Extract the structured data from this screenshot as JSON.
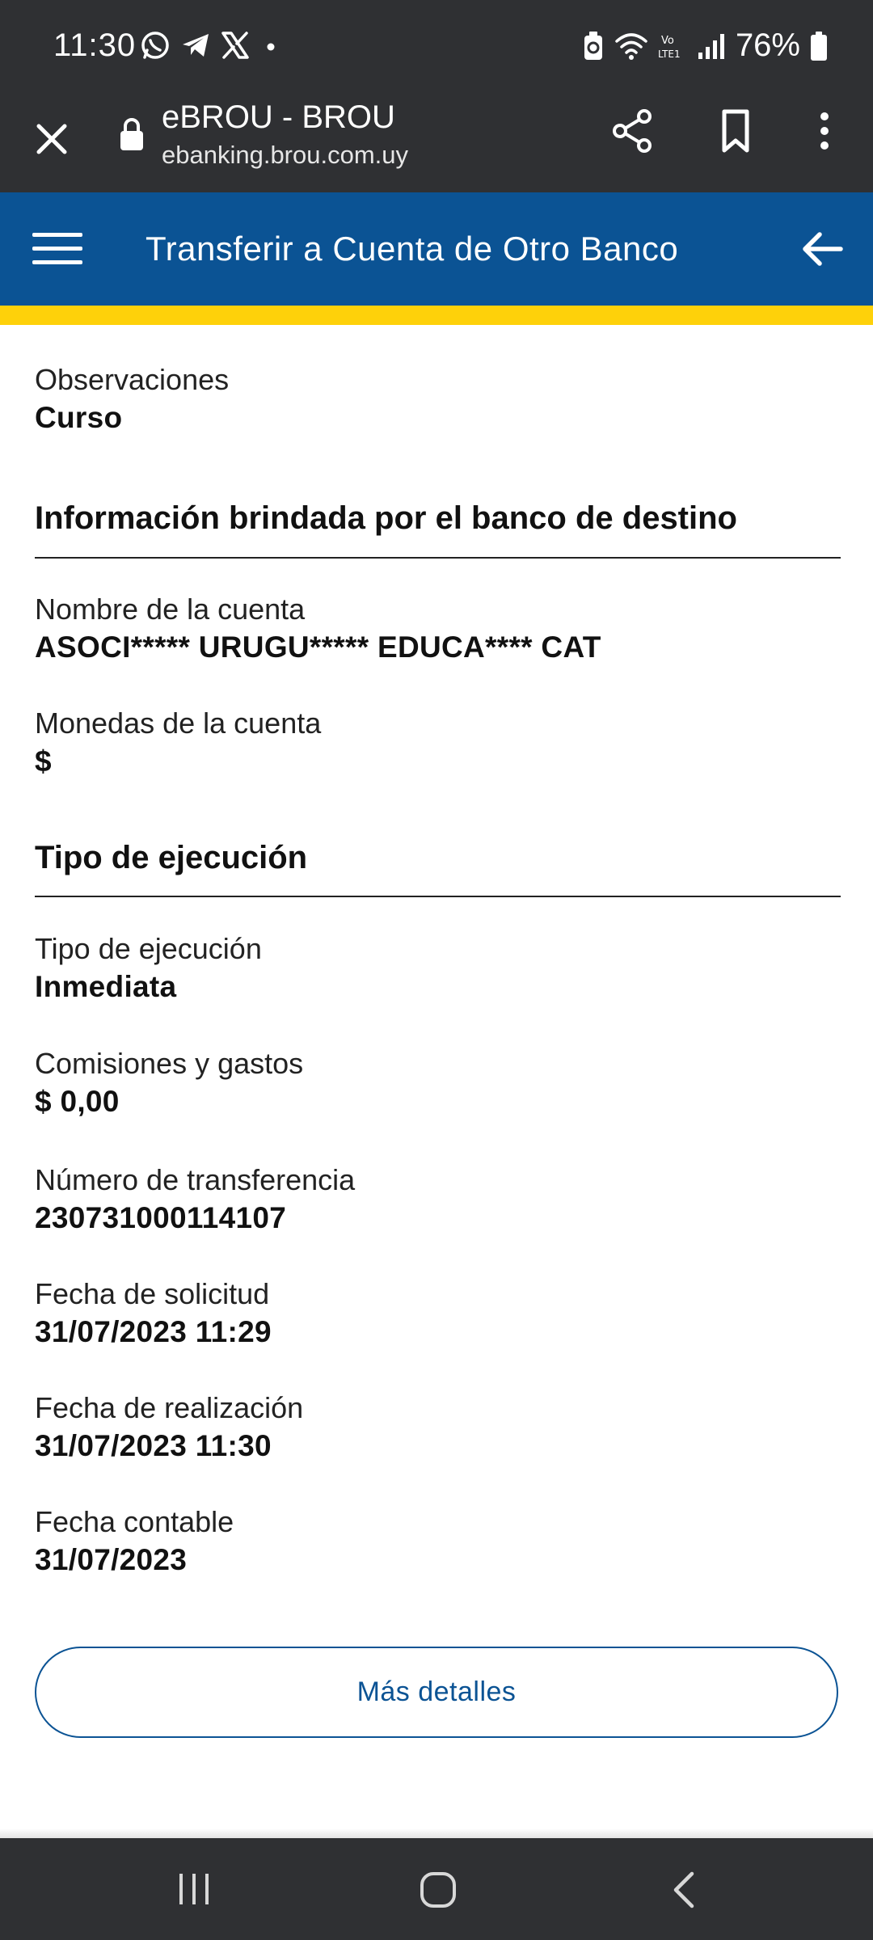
{
  "status_bar": {
    "time": "11:30",
    "battery": "76%",
    "left_icons": [
      "whatsapp-icon",
      "telegram-icon",
      "x-icon",
      "dot-icon"
    ],
    "right_icons": [
      "battery-saver-icon",
      "wifi-icon",
      "volte-icon",
      "signal-icon",
      "battery-icon"
    ]
  },
  "browser": {
    "title": "eBROU - BROU",
    "url": "ebanking.brou.com.uy"
  },
  "header": {
    "title": "Transferir a Cuenta de Otro Banco"
  },
  "colors": {
    "brand_blue": "#0b5394",
    "accent_yellow": "#fed10a",
    "system_bar": "#2f3033"
  },
  "observaciones": {
    "label": "Observaciones",
    "value": "Curso"
  },
  "destino_section": {
    "title": "Información brindada por el banco de destino",
    "fields": [
      {
        "label": "Nombre de la cuenta",
        "value": "ASOCI***** URUGU***** EDUCA**** CAT"
      },
      {
        "label": "Monedas de la cuenta",
        "value": "$"
      }
    ]
  },
  "ejecucion_section": {
    "title": "Tipo de ejecución",
    "fields": [
      {
        "label": "Tipo de ejecución",
        "value": "Inmediata"
      },
      {
        "label": "Comisiones y gastos",
        "value": "$ 0,00"
      },
      {
        "label": "Número de transferencia",
        "value": "230731000114107"
      },
      {
        "label": "Fecha de solicitud",
        "value": "31/07/2023 11:29"
      },
      {
        "label": "Fecha de realización",
        "value": "31/07/2023 11:30"
      },
      {
        "label": "Fecha contable",
        "value": "31/07/2023"
      }
    ]
  },
  "buttons": {
    "more_details": "Más detalles"
  }
}
